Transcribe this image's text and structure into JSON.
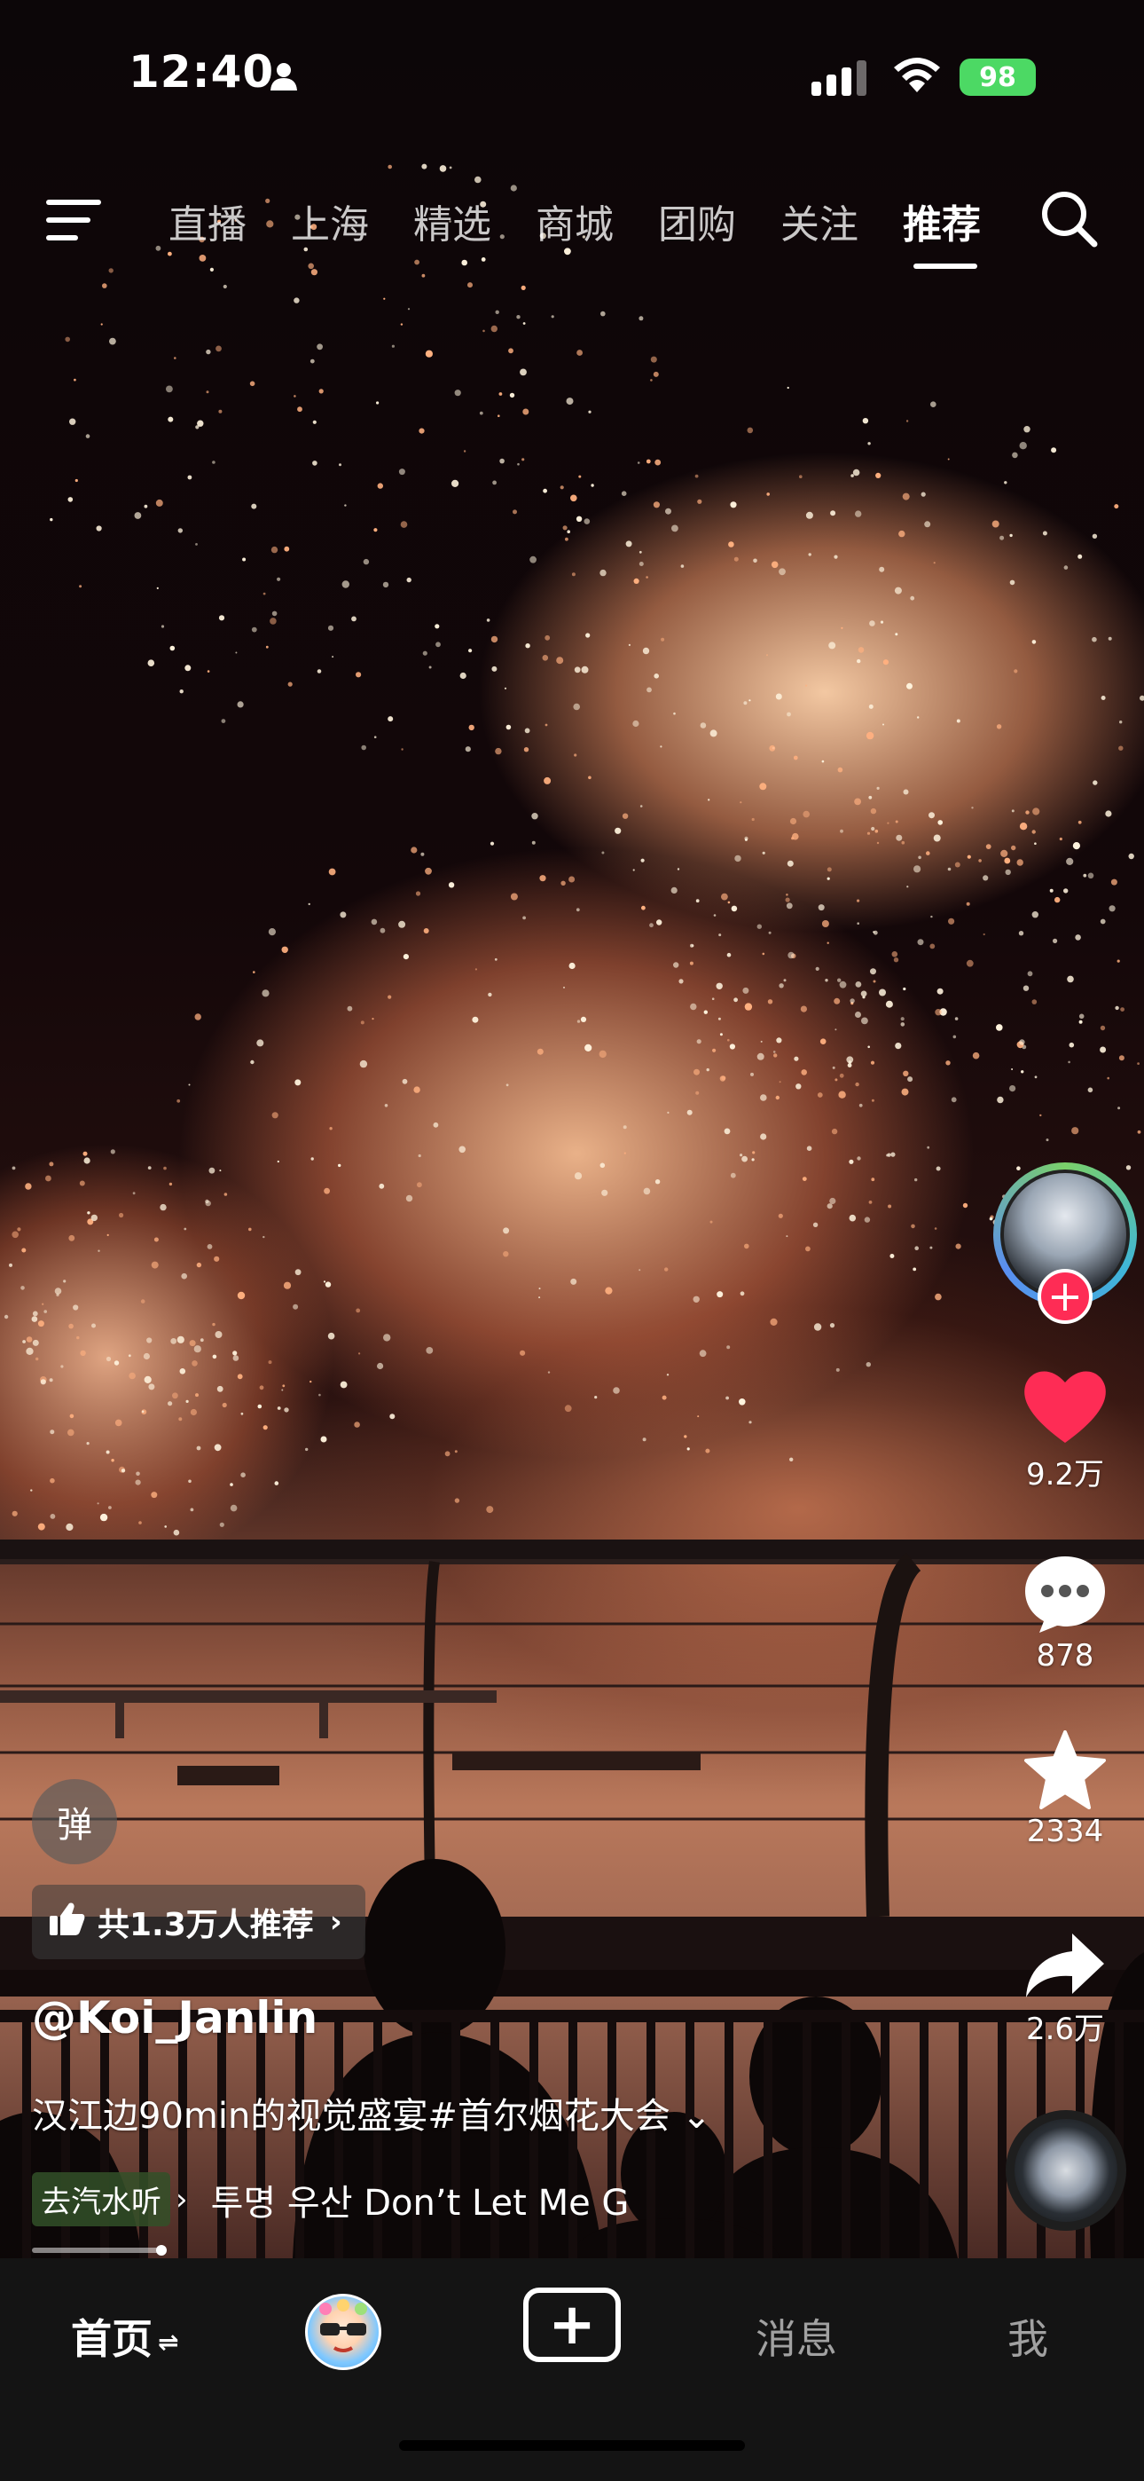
{
  "status_bar": {
    "time": "12:40",
    "battery": "98",
    "icons": [
      "person-icon",
      "signal-icon",
      "wifi-icon",
      "battery-icon"
    ]
  },
  "top_nav": {
    "tabs": [
      "直播",
      "上海",
      "精选",
      "商城",
      "团购",
      "关注",
      "推荐"
    ],
    "active_tab": "推荐",
    "icons": [
      "menu-icon",
      "search-icon"
    ]
  },
  "right_rail": {
    "like_count": "9.2万",
    "comment_count": "878",
    "favorite_count": "2334",
    "share_count": "2.6万",
    "follow_plus": "+",
    "like_color": "#fe2c55"
  },
  "overlay": {
    "danmu_label": "弹",
    "recommend_label": "共1.3万人推荐",
    "author": "@Koi_Janlin",
    "caption": "汉江边90min的视觉盛宴#首尔烟花大会",
    "music_tag": "去汽水听",
    "music_title": "투명 우산 Don’t Let Me G"
  },
  "playback": {
    "progress_fraction": 0.12
  },
  "bottom_nav": {
    "home": "首页",
    "plus": "+",
    "messages": "消息",
    "me": "我"
  }
}
